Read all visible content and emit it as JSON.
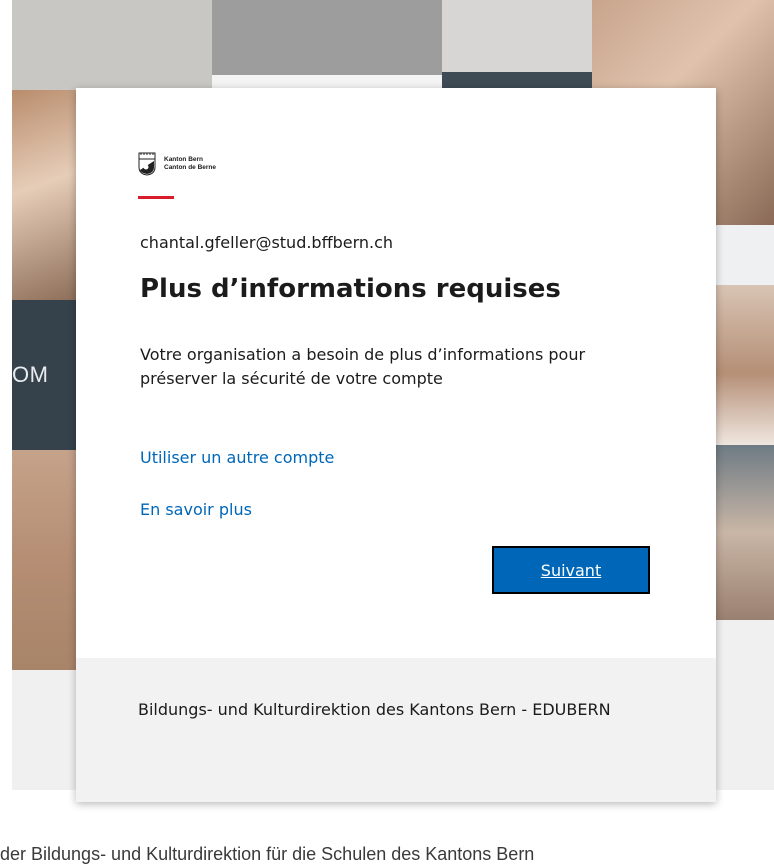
{
  "background": {
    "side_label": "OM",
    "footer_text": "der Bildungs- und Kulturdirektion für die Schulen des Kantons Bern"
  },
  "card": {
    "logo": {
      "line1": "Kanton Bern",
      "line2": "Canton de Berne"
    },
    "email": "chantal.gfeller@stud.bffbern.ch",
    "title": "Plus d’informations requises",
    "description": "Votre organisation a besoin de plus d’informations pour préserver la sécurité de votre compte",
    "links": {
      "other_account": "Utiliser un autre compte",
      "learn_more": "En savoir plus"
    },
    "next_button": "Suivant",
    "footer": "Bildungs- und Kulturdirektion des Kantons Bern - EDUBERN"
  },
  "colors": {
    "accent": "#0067b8",
    "brand_red": "#d91c2b",
    "footer_bg": "#f2f2f2"
  }
}
